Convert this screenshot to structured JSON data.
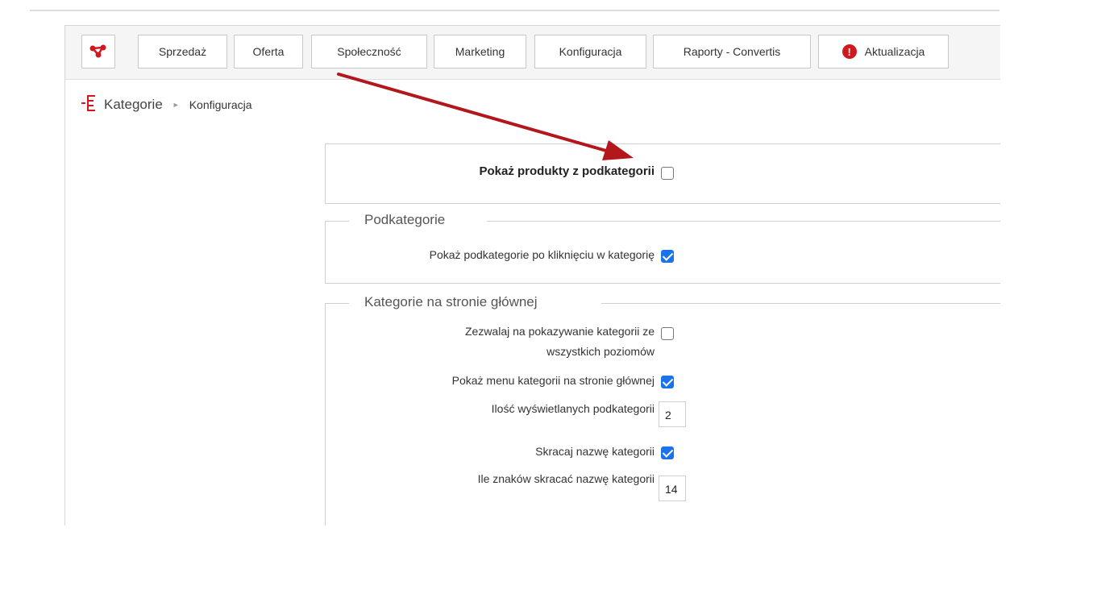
{
  "nav": {
    "items": [
      {
        "label": "Sprzedaż"
      },
      {
        "label": "Oferta"
      },
      {
        "label": "Społeczność"
      },
      {
        "label": "Marketing"
      },
      {
        "label": "Konfiguracja"
      },
      {
        "label": "Raporty - Convertis"
      },
      {
        "label": "Aktualizacja"
      }
    ],
    "alert_symbol": "!"
  },
  "breadcrumb": {
    "title": "Kategorie",
    "separator": "►",
    "current": "Konfiguracja"
  },
  "settings": {
    "show_subcategory_products": {
      "label": "Pokaż produkty z podkategorii",
      "checked": false
    },
    "subcategories": {
      "legend": "Podkategorie",
      "show_on_click": {
        "label": "Pokaż podkategorie po kliknięciu w kategorię",
        "checked": true
      }
    },
    "home_categories": {
      "legend": "Kategorie na stronie głównej",
      "allow_all_levels": {
        "label_line1": "Zezwalaj na pokazywanie kategorii ze",
        "label_line2": "wszystkich poziomów",
        "checked": false
      },
      "show_menu": {
        "label": "Pokaż menu kategorii na stronie głównej",
        "checked": true
      },
      "subcategory_count": {
        "label": "Ilość wyświetlanych podkategorii",
        "value": "2"
      },
      "shorten_name": {
        "label": "Skracaj nazwę kategorii",
        "checked": true
      },
      "shorten_chars": {
        "label": "Ile znaków skracać nazwę kategorii",
        "value": "14"
      }
    }
  },
  "colors": {
    "brand_red": "#d0191f",
    "arrow_red": "#b3171c",
    "checkbox_blue": "#1a73e8"
  },
  "icons": {
    "logo": "connected-nodes-icon",
    "alert": "alert-circle-icon",
    "categories": "category-tree-icon"
  }
}
